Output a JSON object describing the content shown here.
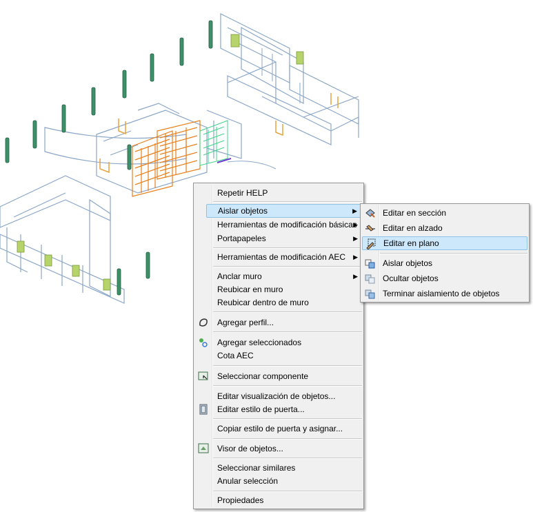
{
  "context_menu": {
    "items": [
      {
        "label": "Repetir HELP"
      },
      {
        "label": "Aislar objetos"
      },
      {
        "label": "Herramientas de modificación básicas"
      },
      {
        "label": "Portapapeles"
      },
      {
        "label": "Herramientas de modificación AEC"
      },
      {
        "label": "Anclar muro"
      },
      {
        "label": "Reubicar en muro"
      },
      {
        "label": "Reubicar dentro de muro"
      },
      {
        "label": "Agregar perfil..."
      },
      {
        "label": "Agregar seleccionados"
      },
      {
        "label": "Cota AEC"
      },
      {
        "label": "Seleccionar componente"
      },
      {
        "label": "Editar visualización de objetos..."
      },
      {
        "label": "Editar estilo de puerta..."
      },
      {
        "label": "Copiar estilo de puerta y asignar..."
      },
      {
        "label": "Visor de objetos..."
      },
      {
        "label": "Seleccionar similares"
      },
      {
        "label": "Anular selección"
      },
      {
        "label": "Propiedades"
      }
    ]
  },
  "submenu": {
    "items": [
      {
        "label": "Editar en sección"
      },
      {
        "label": "Editar en alzado"
      },
      {
        "label": "Editar en plano"
      },
      {
        "label": "Aislar objetos"
      },
      {
        "label": "Ocultar objetos"
      },
      {
        "label": "Terminar aislamiento de objetos"
      }
    ]
  },
  "colors": {
    "highlight": "#cde8fb",
    "menu_bg": "#f0f0f0",
    "wall_lines": "#8aa6c8",
    "door": "#e8a23c",
    "window": "#b7d36b",
    "column": "#3f8f6a",
    "selection": "#e87f1a"
  }
}
